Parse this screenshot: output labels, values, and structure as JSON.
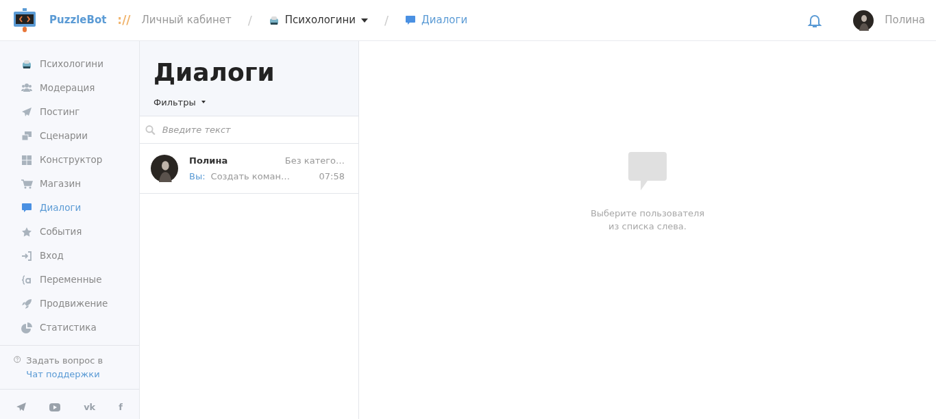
{
  "header": {
    "brand": "PuzzleBot",
    "separator": "://",
    "divider": "/",
    "breadcrumbs": [
      {
        "kind": "plain",
        "label": "Личный кабинет"
      },
      {
        "kind": "bot",
        "label": "Психологини",
        "dropdown": true
      },
      {
        "kind": "chat",
        "label": "Диалоги"
      }
    ],
    "user": {
      "name": "Полина"
    }
  },
  "sidebar": {
    "items": [
      {
        "label": "Психологини",
        "selected": false
      },
      {
        "label": "Модерация",
        "selected": false
      },
      {
        "label": "Постинг",
        "selected": false
      },
      {
        "label": "Сценарии",
        "selected": false
      },
      {
        "label": "Конструктор",
        "selected": false
      },
      {
        "label": "Магазин",
        "selected": false
      },
      {
        "label": "Диалоги",
        "selected": true
      },
      {
        "label": "События",
        "selected": false
      },
      {
        "label": "Вход",
        "selected": false
      },
      {
        "label": "Переменные",
        "selected": false
      },
      {
        "label": "Продвижение",
        "selected": false
      },
      {
        "label": "Статистика",
        "selected": false
      }
    ],
    "support": {
      "text": "Задать вопрос в",
      "link": "Чат поддержки"
    },
    "socials": [
      {
        "kind": "plane"
      },
      {
        "kind": "video"
      },
      {
        "kind": "glyph",
        "glyph": "vk"
      },
      {
        "kind": "glyph",
        "glyph": "f"
      }
    ]
  },
  "dialogs": {
    "title": "Диалоги",
    "filters": "Фильтры",
    "search": {
      "placeholder": "Введите текст"
    },
    "items": [
      {
        "name": "Полина",
        "category": "Без катего…",
        "sender": "Вы:",
        "message": "Создать коман…",
        "time": "07:58",
        "selected": false
      }
    ]
  },
  "empty_state": {
    "text": "Выберите пользователя из списка слева."
  }
}
